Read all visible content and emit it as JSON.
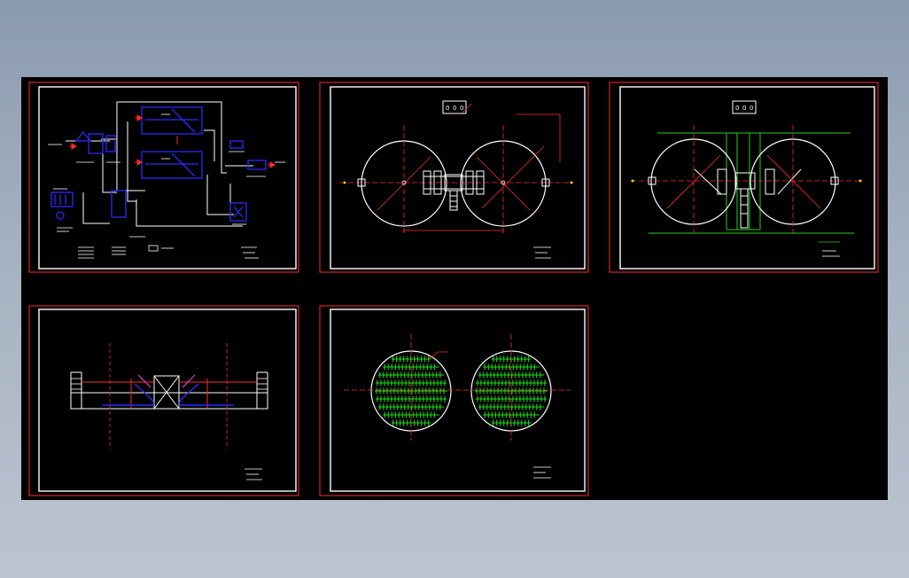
{
  "viewer": {
    "background_color": "#000000",
    "frame_color": "#ff2a2a",
    "inner_frame_color": "#ffffff"
  },
  "colors": {
    "flow_blue": "#2a2aff",
    "pipe_red": "#ff2a2a",
    "line_white": "#ffffff",
    "dim_green": "#22d022",
    "mesh_green": "#1fe01f",
    "tank_magenta": "#ff3fff"
  },
  "sheets": [
    {
      "id": "sheet-1",
      "content": "process-flow-diagram"
    },
    {
      "id": "sheet-2",
      "content": "twin-circular-tank-plan"
    },
    {
      "id": "sheet-3",
      "content": "twin-circular-tank-plan-with-pipes"
    },
    {
      "id": "sheet-4",
      "content": "tank-section-elevation"
    },
    {
      "id": "sheet-5",
      "content": "twin-tank-grid-plan"
    }
  ],
  "labels": {
    "sheet2_box_digits": [
      "0",
      "0",
      "0"
    ],
    "sheet3_box_digits": [
      "0",
      "0",
      "0"
    ]
  }
}
